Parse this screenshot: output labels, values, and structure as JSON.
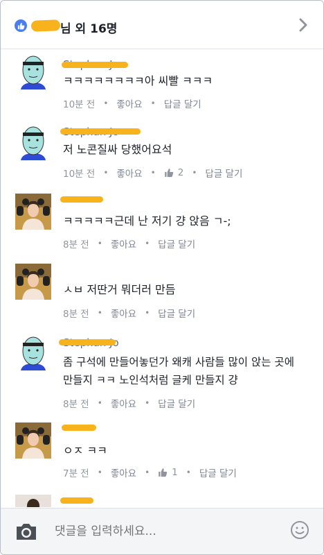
{
  "header": {
    "likes_text": "님 외 16명",
    "icons": {
      "like": "thumbs-up-icon",
      "chevron": "chevron-right-icon"
    }
  },
  "comments": [
    {
      "name": "Stephan Jo",
      "text": "ㅋㅋㅋㅋㅋㅋㅋㅋ아 씨빨 ㅋㅋㅋ",
      "time": "10분 전",
      "like": "좋아요",
      "reply": "답글 달기",
      "likes_count": ""
    },
    {
      "name": "Stephan Jo",
      "text": "저 노콘질싸 당했어요석",
      "time": "10분 전",
      "like": "좋아요",
      "reply": "답글 달기",
      "likes_count": "2"
    },
    {
      "name": "",
      "text": "ㅋㅋㅋㅋㅋ근데 난 저기 걍 앉음 ㄱ-;",
      "time": "8분 전",
      "like": "좋아요",
      "reply": "답글 달기",
      "likes_count": ""
    },
    {
      "name": "",
      "text": "ㅅㅂ 저딴거 뭐더러 만듬",
      "time": "8분 전",
      "like": "좋아요",
      "reply": "답글 달기",
      "likes_count": ""
    },
    {
      "name": "Stephan Jo",
      "text_line1": "좀 구석에 만들어놓던가 왜캐 사람들 많이 앉는 곳에",
      "text_line2": "만들지 ㅋㅋ 노인석처럼 글케 만들지 걍",
      "time": "8분 전",
      "like": "좋아요",
      "reply": "답글 달기",
      "likes_count": ""
    },
    {
      "name": "",
      "text": "ㅇㅈ ㅋㅋ",
      "time": "7분 전",
      "like": "좋아요",
      "reply": "답글 달기",
      "likes_count": "1"
    }
  ],
  "composer": {
    "placeholder": "댓글을 입력하세요...",
    "icons": {
      "camera": "camera-icon",
      "emoji": "smiley-icon"
    }
  },
  "colors": {
    "accent": "#4a7df0",
    "redact": "#f7b21c",
    "meta": "#90949c"
  }
}
